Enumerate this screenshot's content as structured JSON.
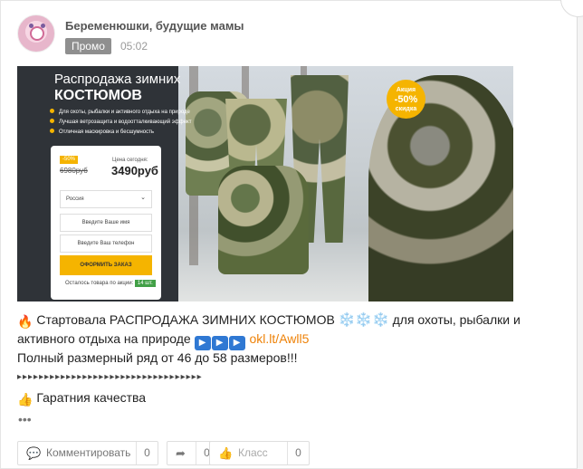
{
  "post": {
    "group_name": "Беременюшки, будущие мамы",
    "promo_label": "Промо",
    "time": "05:02",
    "text": {
      "line1_before": "Стартовала РАСПРОДАЖА ЗИМНИХ КОСТЮМОВ",
      "snowflakes": "❄️❄️❄️",
      "line1_after": " для охоты, рыбалки и",
      "line2_before": "активного отдыха на природе ",
      "play_icons": [
        "▶",
        "▶",
        "▶"
      ],
      "link": "okl.lt/Awll5",
      "line3": "Полный размерный ряд от 46 до 58 размеров!!!",
      "arrows": "▸▸▸▸▸▸▸▸▸▸▸▸▸▸▸▸▸▸▸▸▸▸▸▸▸▸▸▸▸▸▸▸▸▸",
      "line5": "Гаратния качества"
    },
    "more": "•••"
  },
  "ad": {
    "title_line1": "Распродажа зимних",
    "title_line2": "КОСТЮМОВ",
    "bullets": [
      "Для охоты, рыбалки и активного отдыха на природе",
      "Лучшая ветрозащита и водоотталкивающий эффект",
      "Отличная маскировка и бесшумность"
    ],
    "badge": {
      "line1": "Акция",
      "line2": "-50%",
      "line3": "скидка"
    },
    "form": {
      "discount": "-50%",
      "old_price": "6980руб",
      "today_label": "Цена сегодня:",
      "new_price": "3490руб",
      "country": "Россия",
      "name_placeholder": "Введите Ваше имя",
      "phone_placeholder": "Введите Ваш телефон",
      "order_button": "ОФОРМИТЬ ЗАКАЗ",
      "stock_label": "Осталось товара по акции:",
      "stock_count": "14 шт."
    }
  },
  "actions": {
    "comment_label": "Комментировать",
    "comment_count": "0",
    "share_count": "0",
    "like_label": "Класс",
    "like_count": "0"
  },
  "icons": {
    "fire": "fire-icon",
    "snowflake": "snowflake-icon",
    "play": "play-icon",
    "thumbs_up": "thumbs-up-icon",
    "comment": "comment-icon",
    "share": "share-icon",
    "like": "like-icon"
  },
  "colors": {
    "accent": "#ee8208",
    "badge": "#f5b400",
    "promo_bg": "#8f8f8f",
    "play_blue": "#2f78d3"
  }
}
